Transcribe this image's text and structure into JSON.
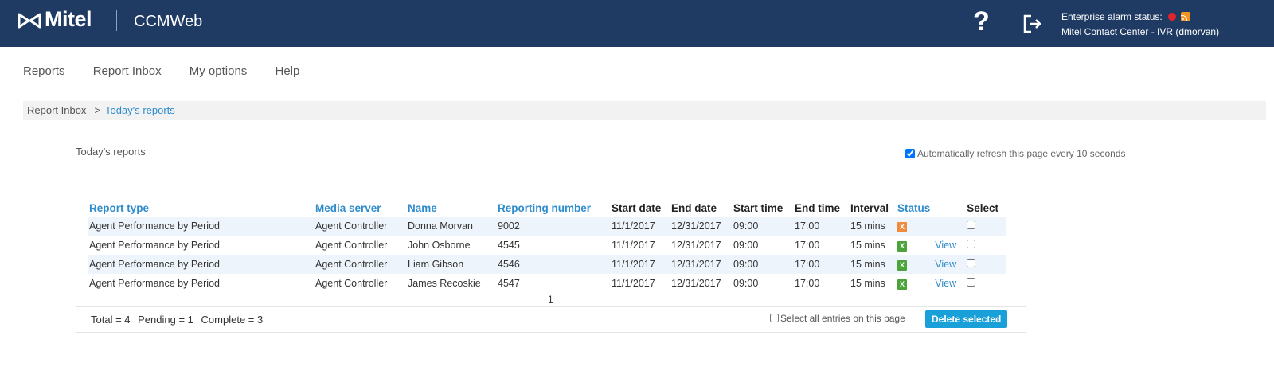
{
  "header": {
    "logo_text": "Mitel",
    "app_name": "CCMWeb",
    "help_label": "?",
    "alarm_label": "Enterprise alarm status:",
    "context": "Mitel Contact Center - IVR (dmorvan)",
    "colors": {
      "bar": "#1f3a63",
      "alarm": "#e0242b",
      "rss": "#f0931f"
    }
  },
  "nav": {
    "items": [
      "Reports",
      "Report Inbox",
      "My options",
      "Help"
    ]
  },
  "breadcrumb": {
    "root": "Report Inbox",
    "separator": ">",
    "current": "Today's reports"
  },
  "page": {
    "title": "Today's reports",
    "auto_refresh_label": "Automatically refresh this page every 10 seconds",
    "auto_refresh_checked": true
  },
  "table": {
    "columns": [
      "Report type",
      "Media server",
      "Name",
      "Reporting number",
      "Start date",
      "End date",
      "Start time",
      "End time",
      "Interval",
      "Status",
      "",
      "Select"
    ],
    "rows": [
      {
        "report_type": "Agent Performance by Period",
        "media_server": "Agent Controller",
        "name": "Donna Morvan",
        "reporting_number": "9002",
        "start_date": "11/1/2017",
        "end_date": "12/31/2017",
        "start_time": "09:00",
        "end_time": "17:00",
        "interval": "15 mins",
        "status": "pending",
        "status_glyph": "X",
        "view": ""
      },
      {
        "report_type": "Agent Performance by Period",
        "media_server": "Agent Controller",
        "name": "John Osborne",
        "reporting_number": "4545",
        "start_date": "11/1/2017",
        "end_date": "12/31/2017",
        "start_time": "09:00",
        "end_time": "17:00",
        "interval": "15 mins",
        "status": "complete",
        "status_glyph": "X",
        "view": "View"
      },
      {
        "report_type": "Agent Performance by Period",
        "media_server": "Agent Controller",
        "name": "Liam Gibson",
        "reporting_number": "4546",
        "start_date": "11/1/2017",
        "end_date": "12/31/2017",
        "start_time": "09:00",
        "end_time": "17:00",
        "interval": "15 mins",
        "status": "complete",
        "status_glyph": "X",
        "view": "View"
      },
      {
        "report_type": "Agent Performance by Period",
        "media_server": "Agent Controller",
        "name": "James Recoskie",
        "reporting_number": "4547",
        "start_date": "11/1/2017",
        "end_date": "12/31/2017",
        "start_time": "09:00",
        "end_time": "17:00",
        "interval": "15 mins",
        "status": "complete",
        "status_glyph": "X",
        "view": "View"
      }
    ]
  },
  "pager": {
    "page": "1"
  },
  "footer": {
    "total": "Total = 4",
    "pending": "Pending = 1",
    "complete": "Complete = 3",
    "select_all_label": "Select all entries on this page",
    "delete_label": "Delete selected"
  }
}
